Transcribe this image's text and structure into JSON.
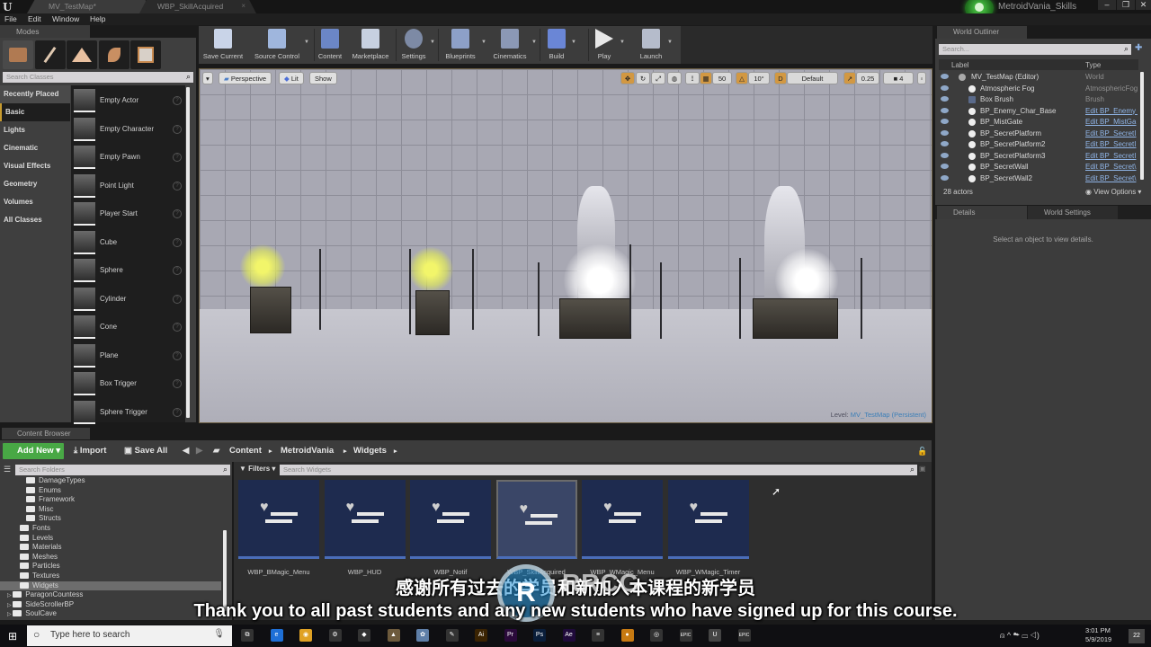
{
  "titlebar": {
    "tabs": [
      {
        "label": "MV_TestMap*"
      },
      {
        "label": "WBP_SkillAcquired"
      }
    ],
    "project_name": "MetroidVania_Skills",
    "window_buttons": {
      "minimize": "–",
      "maximize": "❐",
      "close": "✕"
    }
  },
  "menu": {
    "items": [
      "File",
      "Edit",
      "Window",
      "Help"
    ]
  },
  "modes": {
    "tab_label": "Modes",
    "search_placeholder": "Search Classes",
    "categories": [
      "Recently Placed",
      "Basic",
      "Lights",
      "Cinematic",
      "Visual Effects",
      "Geometry",
      "Volumes",
      "All Classes"
    ],
    "selected_category": "Basic",
    "classes": [
      "Empty Actor",
      "Empty Character",
      "Empty Pawn",
      "Point Light",
      "Player Start",
      "Cube",
      "Sphere",
      "Cylinder",
      "Cone",
      "Plane",
      "Box Trigger",
      "Sphere Trigger"
    ]
  },
  "toolbar": {
    "buttons": [
      {
        "label": "Save Current",
        "icon": "save-icon",
        "color": "#c9d4e8"
      },
      {
        "label": "Source Control",
        "icon": "source-control-icon",
        "color": "#9fb6dd"
      },
      {
        "label": "Content",
        "icon": "content-icon",
        "color": "#6b86c6"
      },
      {
        "label": "Marketplace",
        "icon": "marketplace-icon",
        "color": "#c7d0e0"
      },
      {
        "label": "Settings",
        "icon": "settings-gear-icon",
        "color": "#7d8aa5"
      },
      {
        "label": "Blueprints",
        "icon": "blueprints-icon",
        "color": "#8da0c8"
      },
      {
        "label": "Cinematics",
        "icon": "cinematics-clapper-icon",
        "color": "#8b98b5"
      },
      {
        "label": "Build",
        "icon": "build-icon",
        "color": "#6a86d6"
      },
      {
        "label": "Play",
        "icon": "play-icon",
        "color": "#e8e8e8"
      },
      {
        "label": "Launch",
        "icon": "launch-icon",
        "color": "#b5bccb"
      }
    ]
  },
  "viewport": {
    "view_mode": "Perspective",
    "lighting": "Lit",
    "show": "Show",
    "grid_snap": "50",
    "rotation_snap": "10°",
    "camera_speed_label": "Default",
    "scale_snap": "0.25",
    "camera_speed": "4",
    "level_prefix": "Level:",
    "level_name": "MV_TestMap (Persistent)"
  },
  "outliner": {
    "tab_label": "World Outliner",
    "search_placeholder": "Search...",
    "col_label": "Label",
    "col_type": "Type",
    "rows": [
      {
        "label": "MV_TestMap (Editor)",
        "type": "World",
        "link": false
      },
      {
        "label": "Atmospheric Fog",
        "type": "AtmosphericFog",
        "link": false
      },
      {
        "label": "Box Brush",
        "type": "Brush",
        "link": false
      },
      {
        "label": "BP_Enemy_Char_Base",
        "type": "Edit BP_Enemy_",
        "link": true
      },
      {
        "label": "BP_MistGate",
        "type": "Edit BP_MistGa",
        "link": true
      },
      {
        "label": "BP_SecretPlatform",
        "type": "Edit BP_SecretI",
        "link": true
      },
      {
        "label": "BP_SecretPlatform2",
        "type": "Edit BP_SecretI",
        "link": true
      },
      {
        "label": "BP_SecretPlatform3",
        "type": "Edit BP_SecretI",
        "link": true
      },
      {
        "label": "BP_SecretWall",
        "type": "Edit BP_Secret\\",
        "link": true
      },
      {
        "label": "BP_SecretWall2",
        "type": "Edit BP_Secret\\",
        "link": true
      }
    ],
    "actor_count": "28 actors",
    "view_options": "View Options ▾"
  },
  "details": {
    "tabs": [
      "Details",
      "World Settings"
    ],
    "empty_message": "Select an object to view details."
  },
  "content_browser": {
    "tab_label": "Content Browser",
    "add_new": "Add New ▾",
    "import": "Import",
    "save_all": "Save All",
    "path": [
      "Content",
      "MetroidVania",
      "Widgets"
    ],
    "folder_search_placeholder": "Search Folders",
    "filters": "Filters ▾",
    "asset_search_placeholder": "Search Widgets",
    "folders": [
      {
        "label": "DamageTypes",
        "depth": 2
      },
      {
        "label": "Enums",
        "depth": 2
      },
      {
        "label": "Framework",
        "depth": 2
      },
      {
        "label": "Misc",
        "depth": 2
      },
      {
        "label": "Structs",
        "depth": 2
      },
      {
        "label": "Fonts",
        "depth": 1
      },
      {
        "label": "Levels",
        "depth": 1
      },
      {
        "label": "Materials",
        "depth": 1
      },
      {
        "label": "Meshes",
        "depth": 1
      },
      {
        "label": "Particles",
        "depth": 1
      },
      {
        "label": "Textures",
        "depth": 1
      },
      {
        "label": "Widgets",
        "depth": 1,
        "selected": true
      },
      {
        "label": "ParagonCountess",
        "depth": 0
      },
      {
        "label": "SideScrollerBP",
        "depth": 0
      },
      {
        "label": "SoulCave",
        "depth": 0
      }
    ],
    "assets": [
      {
        "label": "WBP_BMagic_Menu"
      },
      {
        "label": "WBP_HUD"
      },
      {
        "label": "WBP_Notif"
      },
      {
        "label": "WBP_SkillAcquired",
        "hover": true
      },
      {
        "label": "WBP_WMagic_Menu"
      },
      {
        "label": "WBP_WMagic_Timer"
      }
    ]
  },
  "subtitles": {
    "chinese": "感谢所有过去的学员和新加入本课程的新学员",
    "english": "Thank you to all past students and any new students who have signed up for this course."
  },
  "watermark": {
    "logo": "R",
    "text": "RRCG"
  },
  "taskbar": {
    "search_placeholder": "Type here to search",
    "apps": [
      {
        "icon": "task-view-icon",
        "glyph": "⧉",
        "color": "#333"
      },
      {
        "icon": "edge-icon",
        "glyph": "e",
        "color": "#1e6fd6"
      },
      {
        "icon": "chrome-icon",
        "glyph": "◉",
        "color": "#e0a224"
      },
      {
        "icon": "settings-icon",
        "glyph": "⚙",
        "color": "#333"
      },
      {
        "icon": "app-icon",
        "glyph": "◆",
        "color": "#333"
      },
      {
        "icon": "app-icon-2",
        "glyph": "▲",
        "color": "#6d5a3c"
      },
      {
        "icon": "app-icon-3",
        "glyph": "✿",
        "color": "#5f7fa8"
      },
      {
        "icon": "app-icon-4",
        "glyph": "✎",
        "color": "#333"
      },
      {
        "icon": "illustrator-icon",
        "glyph": "Ai",
        "color": "#3a2302"
      },
      {
        "icon": "premiere-icon",
        "glyph": "Pr",
        "color": "#2a0a3a"
      },
      {
        "icon": "photoshop-icon",
        "glyph": "Ps",
        "color": "#0a1e3a"
      },
      {
        "icon": "after-effects-icon",
        "glyph": "Ae",
        "color": "#1f0a3a"
      },
      {
        "icon": "app-icon-5",
        "glyph": "≡",
        "color": "#333"
      },
      {
        "icon": "app-icon-6",
        "glyph": "●",
        "color": "#c77a12"
      },
      {
        "icon": "obs-icon",
        "glyph": "◎",
        "color": "#333"
      },
      {
        "icon": "epic-games-icon",
        "glyph": "EPIC",
        "color": "#333"
      },
      {
        "icon": "unreal-icon",
        "glyph": "U",
        "color": "#444"
      },
      {
        "icon": "epic-games-icon-2",
        "glyph": "EPIC",
        "color": "#333"
      }
    ],
    "clock_time": "3:01 PM",
    "clock_date": "5/9/2019",
    "notification_count": "22"
  }
}
